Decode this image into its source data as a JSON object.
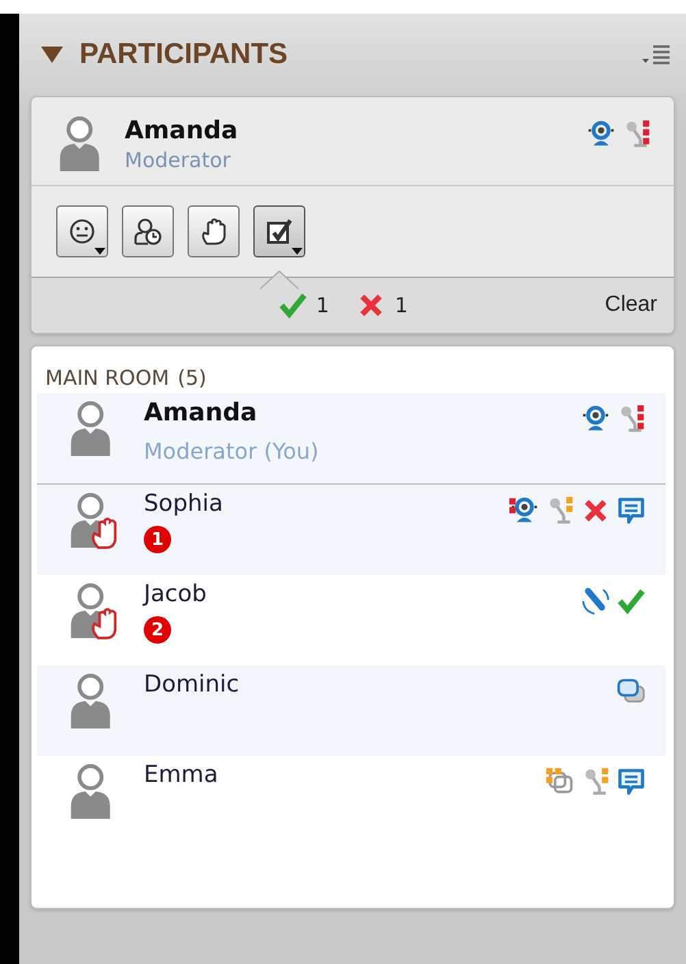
{
  "panel": {
    "title": "PARTICIPANTS",
    "expanded": true
  },
  "me": {
    "name": "Amanda",
    "role": "Moderator",
    "status_icons": [
      {
        "kind": "webcam"
      },
      {
        "kind": "mic-off"
      }
    ]
  },
  "toolbar": [
    {
      "kind": "mood",
      "dropdown": true,
      "selected": false
    },
    {
      "kind": "away",
      "dropdown": false,
      "selected": false
    },
    {
      "kind": "hand",
      "dropdown": false,
      "selected": false
    },
    {
      "kind": "vote",
      "dropdown": true,
      "selected": true
    }
  ],
  "vote_summary": {
    "yes": "1",
    "no": "1",
    "clear": "Clear"
  },
  "room": {
    "title": "MAIN ROOM",
    "count": "(5)",
    "participants": [
      {
        "name": "Amanda",
        "role": "Moderator (You)",
        "is_you": true,
        "hand_raised": false,
        "status_icons": [
          {
            "kind": "webcam"
          },
          {
            "kind": "mic-off"
          }
        ]
      },
      {
        "name": "Sophia",
        "is_you": false,
        "hand_raised": true,
        "hand_order": "1",
        "status_icons": [
          {
            "kind": "webcam-off"
          },
          {
            "kind": "mic-pending"
          },
          {
            "kind": "vote-no"
          },
          {
            "kind": "chat"
          }
        ]
      },
      {
        "name": "Jacob",
        "is_you": false,
        "hand_raised": true,
        "hand_order": "2",
        "status_icons": [
          {
            "kind": "mic-talking"
          },
          {
            "kind": "vote-yes"
          }
        ]
      },
      {
        "name": "Dominic",
        "is_you": false,
        "hand_raised": false,
        "status_icons": [
          {
            "kind": "chat-idle"
          }
        ]
      },
      {
        "name": "Emma",
        "is_you": false,
        "hand_raised": false,
        "status_icons": [
          {
            "kind": "share-pending"
          },
          {
            "kind": "mic-pending"
          },
          {
            "kind": "chat"
          }
        ]
      }
    ]
  }
}
